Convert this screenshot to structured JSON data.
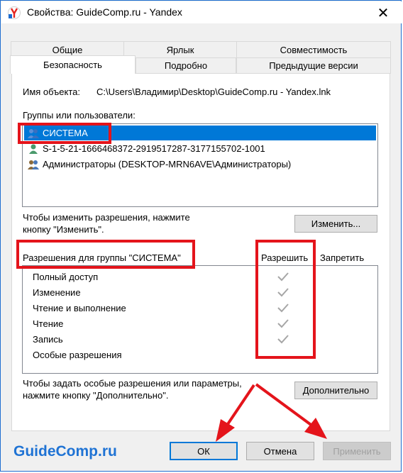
{
  "window": {
    "title": "Свойства: GuideComp.ru - Yandex",
    "close_glyph": "✕"
  },
  "tabs_top": [
    "Общие",
    "Ярлык",
    "Совместимость"
  ],
  "tabs_bottom": [
    "Безопасность",
    "Подробно",
    "Предыдущие версии"
  ],
  "object": {
    "label": "Имя объекта:",
    "value": "C:\\Users\\Владимир\\Desktop\\GuideComp.ru - Yandex.lnk"
  },
  "groups": {
    "label": "Группы или пользователи:",
    "items": [
      {
        "name": "СИСТЕМА",
        "icon": "users-group-icon"
      },
      {
        "name": "S-1-5-21-1666468372-2919517287-3177155702-1001",
        "icon": "user-single-icon"
      },
      {
        "name": "Администраторы (DESKTOP-MRN6AVE\\Администраторы)",
        "icon": "admins-group-icon"
      }
    ]
  },
  "change_hint": {
    "line1": "Чтобы изменить разрешения, нажмите",
    "line2": "кнопку \"Изменить\"."
  },
  "change_button": "Изменить...",
  "permissions": {
    "label": "Разрешения для группы \"СИСТЕМА\"",
    "allow_header": "Разрешить",
    "deny_header": "Запретить",
    "rows": [
      {
        "name": "Полный доступ",
        "allow": true
      },
      {
        "name": "Изменение",
        "allow": true
      },
      {
        "name": "Чтение и выполнение",
        "allow": true
      },
      {
        "name": "Чтение",
        "allow": true
      },
      {
        "name": "Запись",
        "allow": true
      },
      {
        "name": "Особые разрешения",
        "allow": false
      }
    ]
  },
  "advanced_hint": {
    "line1": "Чтобы задать особые разрешения или параметры,",
    "line2": "нажмите кнопку \"Дополнительно\"."
  },
  "advanced_button": "Дополнительно",
  "footer": {
    "ok": "ОК",
    "cancel": "Отмена",
    "apply": "Применить"
  },
  "watermark": "GuideComp.ru",
  "colors": {
    "accent": "#0078d7",
    "highlight": "#e4141b",
    "watermark": "#1f73d4"
  }
}
